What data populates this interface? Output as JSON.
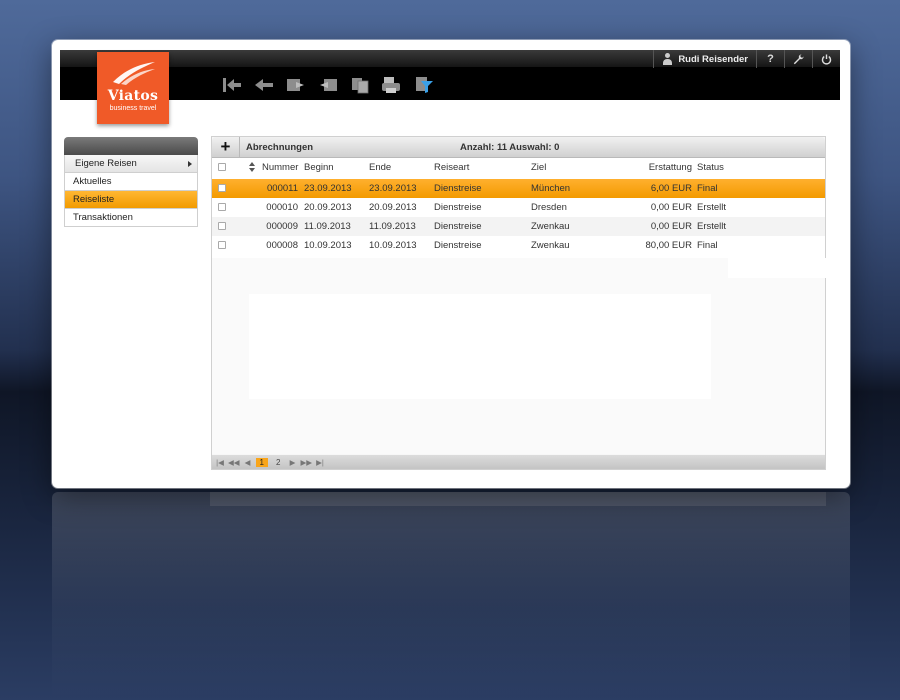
{
  "app": {
    "brand": "Viatos",
    "tagline": "business travel"
  },
  "header": {
    "user_name": "Rudi Reisender",
    "help_label": "?",
    "settings_icon": "wrench-icon",
    "logout_icon": "power-icon"
  },
  "toolbar": {
    "icons": [
      "first-icon",
      "back-icon",
      "forward-document-icon",
      "return-document-icon",
      "copy-document-icon",
      "print-icon",
      "filter-icon"
    ]
  },
  "sidebar": {
    "group_label": "Eigene Reisen",
    "items": [
      {
        "label": "Aktuelles",
        "active": false
      },
      {
        "label": "Reiseliste",
        "active": true
      },
      {
        "label": "Transaktionen",
        "active": false
      }
    ]
  },
  "panel": {
    "add_label": "+",
    "title": "Abrechnungen",
    "count_text": "Anzahl: 11 Auswahl: 0"
  },
  "table": {
    "columns": [
      "Nummer",
      "Beginn",
      "Ende",
      "Reiseart",
      "Ziel",
      "Erstattung",
      "Status"
    ],
    "rows": [
      {
        "nummer": "000011",
        "beginn": "23.09.2013",
        "ende": "23.09.2013",
        "reiseart": "Dienstreise",
        "ziel": "München",
        "erstattung": "6,00 EUR",
        "status": "Final",
        "selected": true
      },
      {
        "nummer": "000010",
        "beginn": "20.09.2013",
        "ende": "20.09.2013",
        "reiseart": "Dienstreise",
        "ziel": "Dresden",
        "erstattung": "0,00 EUR",
        "status": "Erstellt",
        "selected": false
      },
      {
        "nummer": "000009",
        "beginn": "11.09.2013",
        "ende": "11.09.2013",
        "reiseart": "Dienstreise",
        "ziel": "Zwenkau",
        "erstattung": "0,00 EUR",
        "status": "Erstellt",
        "selected": false
      },
      {
        "nummer": "000008",
        "beginn": "10.09.2013",
        "ende": "10.09.2013",
        "reiseart": "Dienstreise",
        "ziel": "Zwenkau",
        "erstattung": "80,00 EUR",
        "status": "Final",
        "selected": false
      }
    ]
  },
  "pager": {
    "pages": [
      "1",
      "2"
    ],
    "current_page": "1"
  },
  "colors": {
    "brand": "#f05a28",
    "highlight": "#f39a00"
  }
}
